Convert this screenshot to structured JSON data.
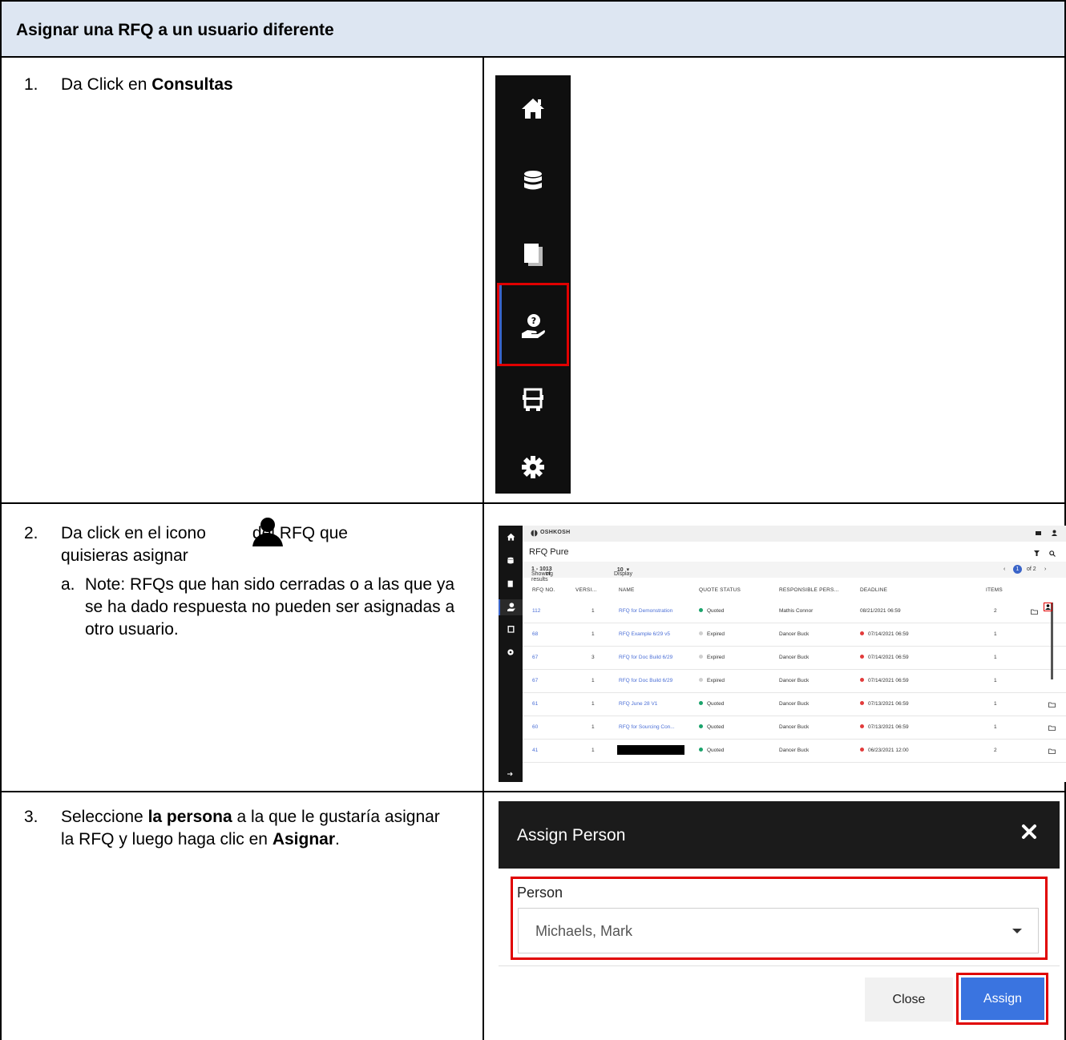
{
  "header": {
    "title": "Asignar una RFQ a un usuario diferente"
  },
  "step1": {
    "num": "1.",
    "text_pre": "Da Click en ",
    "text_bold": "Consultas",
    "sidebar_icons": [
      "home-icon",
      "database-icon",
      "documents-icon",
      "inquiry-hand-icon",
      "truck-icon",
      "gear-icon"
    ]
  },
  "step2": {
    "num": "2.",
    "text_pre": "Da click en el icono",
    "text_post": "del RFQ que",
    "text_line2": "quisieras asignar",
    "note_num": "a.",
    "note_text": "Note: RFQs que han sido cerradas o a las que ya se ha dado respuesta no pueden ser asignadas a otro usuario.",
    "app": {
      "brand": "OSHKOSH",
      "title": "RFQ Pure",
      "showing_pre": "Showing results ",
      "showing_range": "1 - 10",
      "showing_of": " of ",
      "showing_total": "13",
      "display_label": "Display",
      "display_value": "10",
      "page_current": "1",
      "page_of": "of 2",
      "columns": [
        "RFQ NO.",
        "VERSI...",
        "NAME",
        "QUOTE STATUS",
        "RESPONSIBLE PERS...",
        "DEADLINE",
        "ITEMS"
      ],
      "rows": [
        {
          "rfq": "112",
          "ver": "1",
          "name": "RFQ for Demonstration",
          "status": "Quoted",
          "person": "Mathis Connor",
          "deadline": "08/21/2021 06:59",
          "items": "2"
        },
        {
          "rfq": "68",
          "ver": "1",
          "name": "RFQ Example 6/29 v5",
          "status": "Expired",
          "person": "Dancer Buck",
          "deadline": "07/14/2021 06:59",
          "items": "1"
        },
        {
          "rfq": "67",
          "ver": "3",
          "name": "RFQ for Doc Build 6/29",
          "status": "Expired",
          "person": "Dancer Buck",
          "deadline": "07/14/2021 06:59",
          "items": "1"
        },
        {
          "rfq": "67",
          "ver": "1",
          "name": "RFQ for Doc Build 6/29",
          "status": "Expired",
          "person": "Dancer Buck",
          "deadline": "07/14/2021 06:59",
          "items": "1"
        },
        {
          "rfq": "61",
          "ver": "1",
          "name": "RFQ June 28 V1",
          "status": "Quoted",
          "person": "Dancer Buck",
          "deadline": "07/13/2021 06:59",
          "items": "1"
        },
        {
          "rfq": "60",
          "ver": "1",
          "name": "RFQ for Sourcing Con...",
          "status": "Quoted",
          "person": "Dancer Buck",
          "deadline": "07/13/2021 06:59",
          "items": "1"
        },
        {
          "rfq": "41",
          "ver": "1",
          "name": "",
          "status": "Quoted",
          "person": "Dancer Buck",
          "deadline": "06/23/2021 12:00",
          "items": "2"
        }
      ]
    }
  },
  "step3": {
    "num": "3.",
    "text_pre": "Seleccione ",
    "text_bold1": "la persona",
    "text_mid": " a la que le gustaría asignar la RFQ y luego haga clic en ",
    "text_bold2": "Asignar",
    "text_end": ".",
    "dialog": {
      "title": "Assign Person",
      "person_label": "Person",
      "person_value": "Michaels, Mark",
      "close_label": "Close",
      "assign_label": "Assign"
    }
  },
  "colors": {
    "header_bg": "#dde6f2",
    "highlight": "#e00000",
    "link": "#4b6fd6",
    "quoted": "#1aa36b",
    "expired_status": "#cfcfcf",
    "deadline_overdue": "#e23b3b",
    "assign_button": "#3a74e0"
  }
}
